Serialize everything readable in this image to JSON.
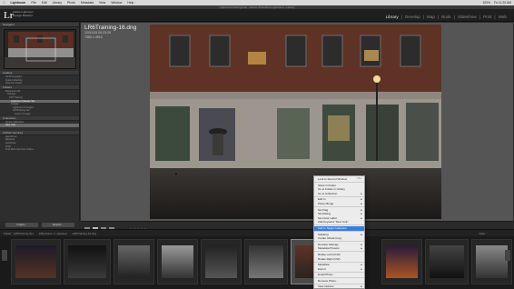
{
  "menubar": {
    "app": "Lightroom",
    "items": [
      "File",
      "Edit",
      "Library",
      "Photo",
      "Metadata",
      "View",
      "Window",
      "Help"
    ],
    "status": [
      "100%",
      "Fri 11:20 AM"
    ]
  },
  "window": {
    "title": "LightroomTraining.lrcat - Adobe Photoshop Lightroom - Library"
  },
  "identity": {
    "logo": "Lr",
    "line1": "Adobe Lightroom",
    "line2": "George Banfield"
  },
  "modules": [
    "Library",
    "Develop",
    "Map",
    "Book",
    "Slideshow",
    "Print",
    "Web"
  ],
  "active_module": "Library",
  "left_panel": {
    "navigator": "Navigator",
    "catalog": {
      "title": "Catalog",
      "rows": [
        "All Photographs",
        "Quick Collection",
        "Previous Import"
      ]
    },
    "folders": {
      "title": "Folders",
      "rows": [
        "Macintosh HD",
        "Storage",
        "LR6 Training",
        "Lightroom Classes Set",
        "Images",
        "Lightroom 6 Images",
        "LR6Training Set",
        "Lesson Images"
      ],
      "selected_index": 3
    },
    "collections": {
      "title": "Collections",
      "rows": [
        "Smart Collections",
        "New York"
      ]
    },
    "publish": {
      "title": "Publish Services",
      "rows": [
        "Hard Drive",
        "Behance",
        "Facebook",
        "Flickr",
        "Find More Services Online..."
      ]
    }
  },
  "left_buttons": {
    "import": "Import...",
    "export": "Export..."
  },
  "photo_info": {
    "filename": "LR6Training-16.dng",
    "date": "12/01/15 00:23:29",
    "dims": "7360 x 4912"
  },
  "filmstrip_bar": {
    "text": "Folder : LR6Training Set",
    "count": "108 photos / 1 selected",
    "file": "LR6Training-16.dng",
    "filter": "Filter :"
  },
  "context_menu": {
    "items": [
      {
        "label": "Lock to Second Window",
        "shortcut": "⇧⌘↵"
      },
      {
        "sep": true
      },
      {
        "label": "Show in Finder"
      },
      {
        "label": "Go to Folder in Library"
      },
      {
        "label": "Go to Collection",
        "arrow": true
      },
      {
        "sep": true
      },
      {
        "label": "Edit In",
        "arrow": true
      },
      {
        "label": "Photo Merge",
        "arrow": true
      },
      {
        "sep": true
      },
      {
        "label": "Set Flag",
        "arrow": true
      },
      {
        "label": "Set Rating",
        "arrow": true
      },
      {
        "label": "Set Color Label",
        "arrow": true
      },
      {
        "label": "Add Keyword \"New York\""
      },
      {
        "sep": true
      },
      {
        "label": "Add to Target Collection",
        "highlighted": true
      },
      {
        "sep": true
      },
      {
        "label": "Stacking",
        "arrow": true
      },
      {
        "label": "Create Virtual Copy"
      },
      {
        "sep": true
      },
      {
        "label": "Develop Settings",
        "arrow": true
      },
      {
        "label": "Metadata Presets",
        "arrow": true
      },
      {
        "sep": true
      },
      {
        "label": "Rotate Left (CCW)"
      },
      {
        "label": "Rotate Right (CW)"
      },
      {
        "sep": true
      },
      {
        "label": "Metadata",
        "arrow": true
      },
      {
        "label": "Export",
        "arrow": true
      },
      {
        "sep": true
      },
      {
        "label": "Email Photo..."
      },
      {
        "sep": true
      },
      {
        "label": "Remove Photo..."
      },
      {
        "sep": true
      },
      {
        "label": "View Options",
        "arrow": true
      }
    ]
  },
  "colors": {
    "accent": "#3d7bd9",
    "panel": "#2e2e2e",
    "background": "#555555"
  }
}
